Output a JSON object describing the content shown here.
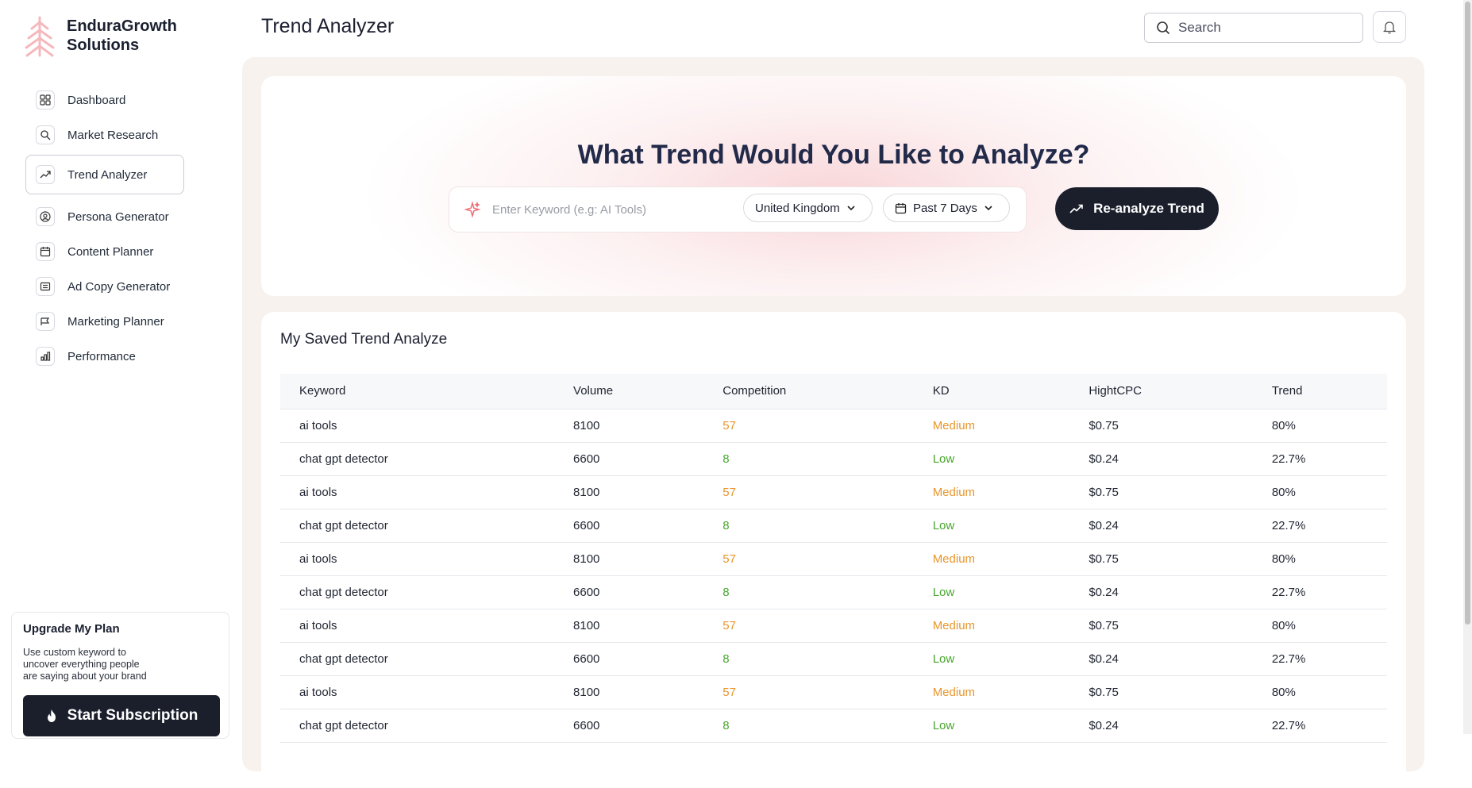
{
  "brand": {
    "line1": "EnduraGrowth",
    "line2": "Solutions"
  },
  "sidebar": {
    "items": [
      {
        "label": "Dashboard",
        "icon": "grid-icon",
        "active": false
      },
      {
        "label": "Market Research",
        "icon": "search-icon",
        "active": false
      },
      {
        "label": "Trend Analyzer",
        "icon": "trend-icon",
        "active": true
      },
      {
        "label": "Persona Generator",
        "icon": "persona-icon",
        "active": false
      },
      {
        "label": "Content Planner",
        "icon": "calendar-icon",
        "active": false
      },
      {
        "label": "Ad Copy Generator",
        "icon": "adcopy-icon",
        "active": false
      },
      {
        "label": "Marketing Planner",
        "icon": "megaphone-icon",
        "active": false
      },
      {
        "label": "Performance",
        "icon": "chart-icon",
        "active": false
      }
    ],
    "upgrade": {
      "title": "Upgrade My Plan",
      "description_line1": "Use custom keyword to",
      "description_line2": "uncover everything people",
      "description_line3": "are saying about your brand",
      "button_label": "Start Subscription"
    }
  },
  "header": {
    "title": "Trend Analyzer",
    "search_placeholder": "Search"
  },
  "hero": {
    "title": "What Trend Would You Like to Analyze?",
    "keyword_placeholder": "Enter Keyword (e.g: AI Tools)",
    "country": "United Kingdom",
    "period": "Past 7 Days",
    "button_label": "Re-analyze Trend"
  },
  "saved": {
    "title": "My Saved Trend Analyze",
    "columns": [
      "Keyword",
      "Volume",
      "Competition",
      "KD",
      "HightCPC",
      "Trend"
    ],
    "rows": [
      [
        "ai tools",
        "8100",
        "57",
        "Medium",
        "$0.75",
        "80%"
      ],
      [
        "chat gpt detector",
        "6600",
        "8",
        "Low",
        "$0.24",
        "22.7%"
      ],
      [
        "ai tools",
        "8100",
        "57",
        "Medium",
        "$0.75",
        "80%"
      ],
      [
        "chat gpt detector",
        "6600",
        "8",
        "Low",
        "$0.24",
        "22.7%"
      ],
      [
        "ai tools",
        "8100",
        "57",
        "Medium",
        "$0.75",
        "80%"
      ],
      [
        "chat gpt detector",
        "6600",
        "8",
        "Low",
        "$0.24",
        "22.7%"
      ],
      [
        "ai tools",
        "8100",
        "57",
        "Medium",
        "$0.75",
        "80%"
      ],
      [
        "chat gpt detector",
        "6600",
        "8",
        "Low",
        "$0.24",
        "22.7%"
      ],
      [
        "ai tools",
        "8100",
        "57",
        "Medium",
        "$0.75",
        "80%"
      ],
      [
        "chat gpt detector",
        "6600",
        "8",
        "Low",
        "$0.24",
        "22.7%"
      ]
    ]
  },
  "colors": {
    "accent_dark": "#1b1f2c",
    "medium": "#e8952b",
    "low": "#4aa630",
    "brand_pink": "#f2b8bd",
    "panel_bg": "#f8f2ee"
  }
}
